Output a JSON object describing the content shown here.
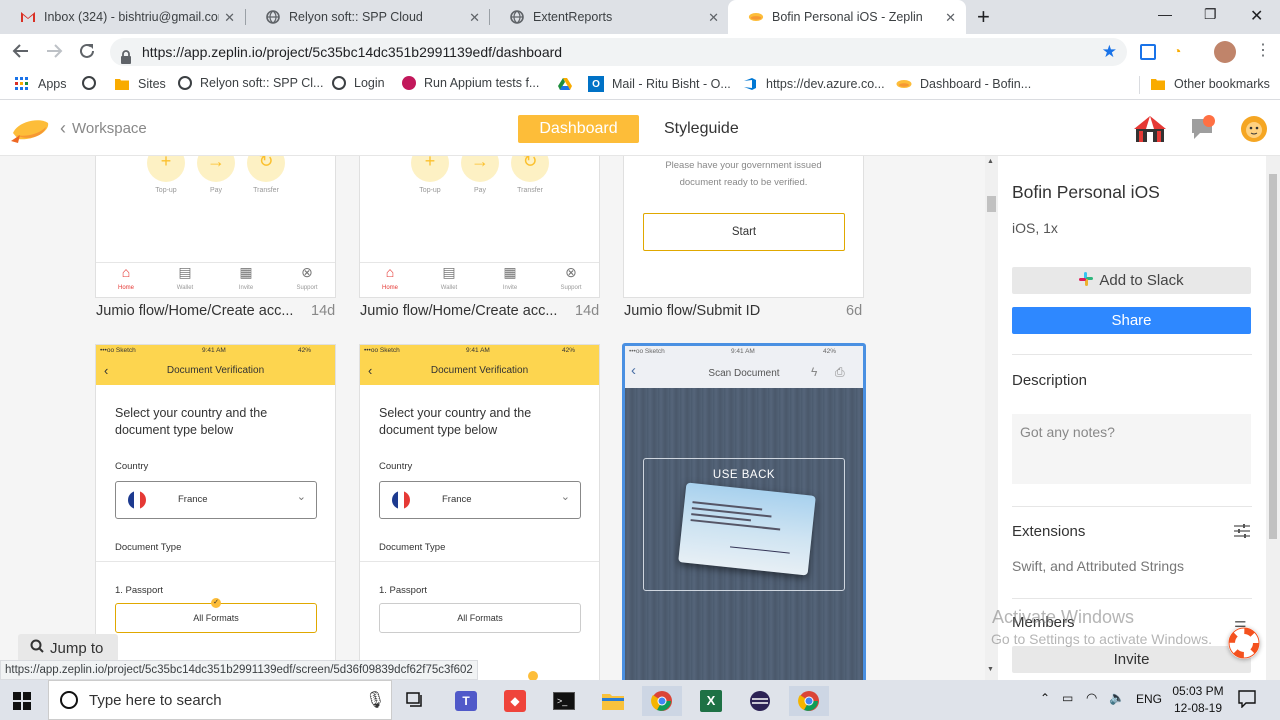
{
  "browser": {
    "tabs": [
      {
        "title": "Inbox (324) - bishtriu@gmail.com",
        "icon": "gmail-icon"
      },
      {
        "title": "Relyon soft:: SPP Cloud",
        "icon": "globe-icon"
      },
      {
        "title": "ExtentReports",
        "icon": "globe-icon"
      },
      {
        "title": "Bofin Personal iOS - Zeplin",
        "icon": "zeplin-icon"
      }
    ],
    "new_tab": "+",
    "url": "https://app.zeplin.io/project/5c35bc14dc351b2991139edf/dashboard",
    "bookmarks": [
      {
        "label": "Apps"
      },
      {
        "label": ""
      },
      {
        "label": "Sites"
      },
      {
        "label": "Relyon soft:: SPP Cl..."
      },
      {
        "label": "Login"
      },
      {
        "label": "Run Appium tests f..."
      },
      {
        "label": ""
      },
      {
        "label": "Mail - Ritu Bisht - O..."
      },
      {
        "label": "https://dev.azure.co..."
      },
      {
        "label": "Dashboard - Bofin..."
      },
      {
        "label": "Other bookmarks"
      }
    ]
  },
  "zeplin": {
    "workspace_link": "Workspace",
    "tab_dashboard": "Dashboard",
    "tab_styleguide": "Styleguide"
  },
  "screens": {
    "row1": [
      {
        "caption": "Jumio flow/Home/Create acc...",
        "age": "14d"
      },
      {
        "caption": "Jumio flow/Home/Create acc...",
        "age": "14d"
      },
      {
        "caption": "Jumio flow/Submit ID",
        "age": "6d"
      }
    ],
    "home": {
      "actions": [
        "Top-up",
        "Pay",
        "Transfer"
      ],
      "tabs": [
        "Home",
        "Wallet",
        "Invite",
        "Support"
      ]
    },
    "submit": {
      "note_line1": "Please have your government issued",
      "note_line2": "document ready to be verified.",
      "start": "Start"
    },
    "docv": {
      "status_carrier": "•••oo Sketch",
      "status_time": "9:41 AM",
      "status_battery": "42%",
      "title": "Document Verification",
      "heading": "Select your country and the document type below",
      "country_label": "Country",
      "country_value": "France",
      "doctype_label": "Document Type",
      "passport": "1. Passport",
      "formats": "All Formats"
    },
    "scan": {
      "title": "Scan Document",
      "overlay": "USE BACK"
    }
  },
  "jump_to": "Jump to",
  "status_url": "https://app.zeplin.io/project/5c35bc14dc351b2991139edf/screen/5d36f09839dcf62f75c3f602",
  "panel": {
    "project_name": "Bofin Personal iOS",
    "platform": "iOS, 1x",
    "add_to_slack": "Add to Slack",
    "share": "Share",
    "description_title": "Description",
    "notes_placeholder": "Got any notes?",
    "extensions_title": "Extensions",
    "extensions_value": "Swift, and Attributed Strings",
    "members_title": "Members",
    "invite": "Invite"
  },
  "watermark": {
    "line1": "Activate Windows",
    "line2": "Go to Settings to activate Windows."
  },
  "taskbar": {
    "search_placeholder": "Type here to search",
    "lang": "ENG",
    "time": "05:03 PM",
    "date": "12-08-19"
  },
  "colors": {
    "zeplin_orange": "#fdbd39",
    "share_blue": "#2e88ff",
    "card_yellow": "#fdd54f",
    "selected_blue": "#4a90e2"
  }
}
